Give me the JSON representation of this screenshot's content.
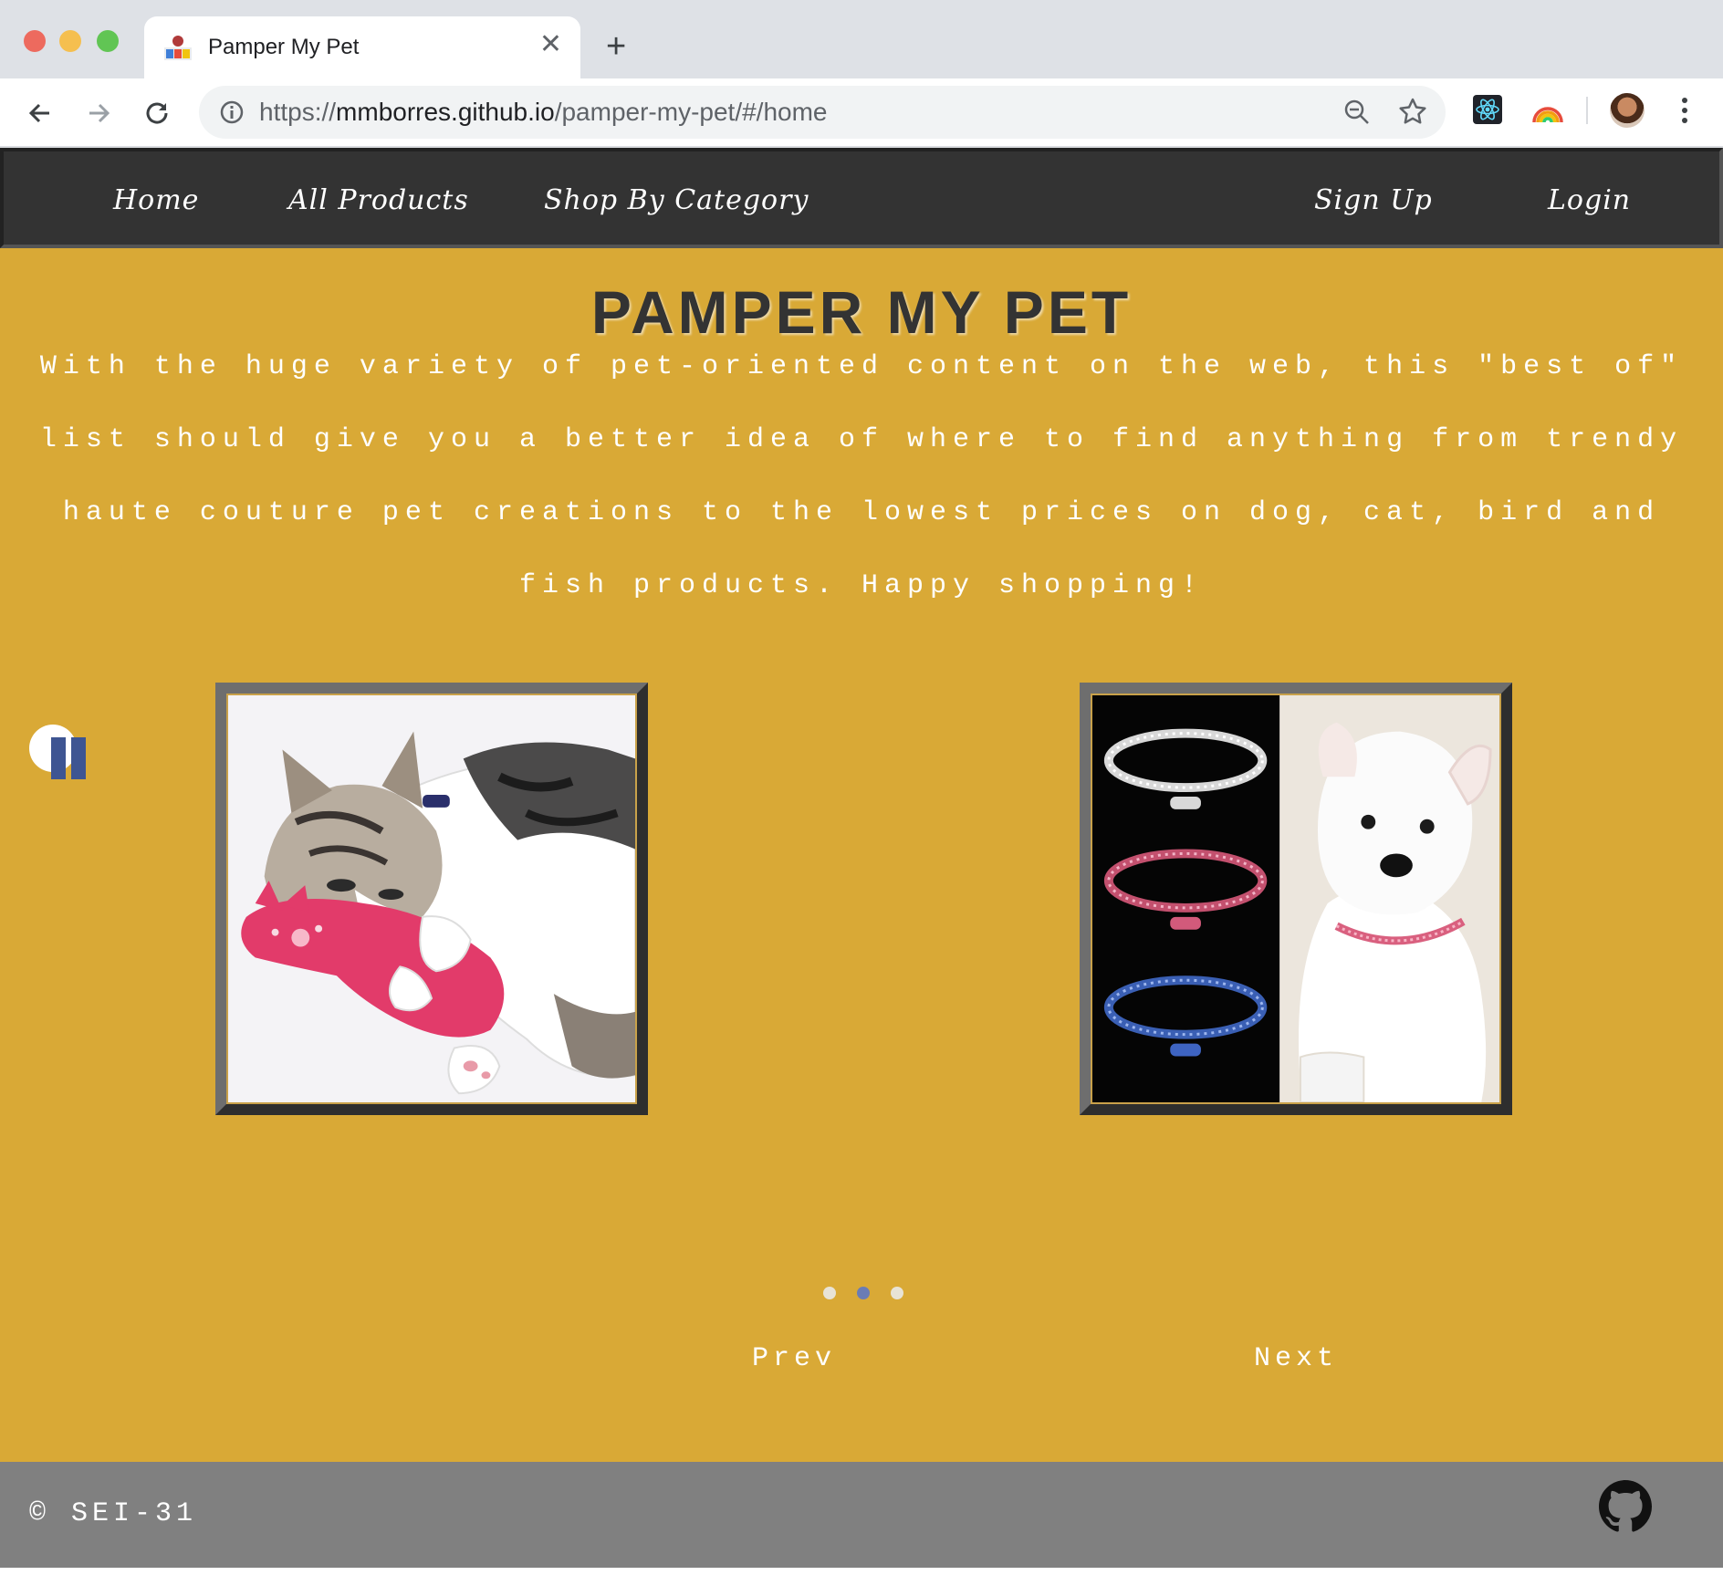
{
  "browser": {
    "tab_title": "Pamper My Pet",
    "tab_close": "✕",
    "new_tab": "+",
    "url_scheme": "https://",
    "url_host": "mmborres.github.io",
    "url_path": "/pamper-my-pet/#/home"
  },
  "nav": {
    "home": "Home",
    "all_products": "All Products",
    "shop_by_category": "Shop By Category",
    "sign_up": "Sign Up",
    "login": "Login"
  },
  "main": {
    "title": "PAMPER MY PET",
    "intro": "With the huge variety of pet-oriented content on the web, this \"best of\" list should give you a better idea of where to find anything from trendy haute couture pet creations to the lowest prices on dog, cat, bird and fish products. Happy shopping!",
    "carousel": {
      "slides": [
        "cat-with-toy-photo",
        "dog-collar-photo"
      ],
      "active_index": 1,
      "dot_count": 3
    },
    "prev_label": "Prev",
    "next_label": "Next"
  },
  "footer": {
    "copyright": "© SEI-31"
  },
  "colors": {
    "page_background": "#d9a936",
    "nav_background": "#333333",
    "footer_background": "#808080",
    "active_dot": "#6a7cb5"
  }
}
